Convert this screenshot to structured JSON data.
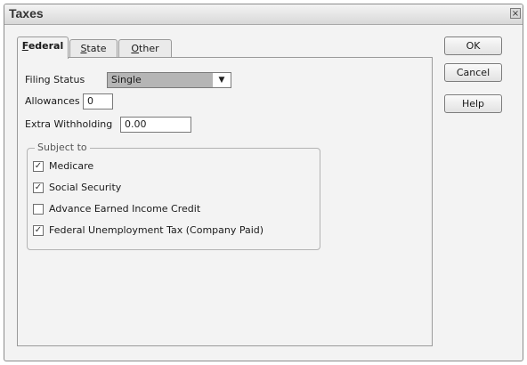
{
  "window": {
    "title": "Taxes",
    "close_glyph": "×"
  },
  "tabs": [
    {
      "label_u": "F",
      "label_rest": "ederal",
      "active": true
    },
    {
      "label_u": "S",
      "label_rest": "tate",
      "active": false
    },
    {
      "label_u": "O",
      "label_rest": "ther",
      "active": false
    }
  ],
  "form": {
    "filing_status_label": "Filing Status",
    "filing_status_value": "Single",
    "dropdown_arrow": "▼",
    "allowances_label": "Allowances",
    "allowances_value": "0",
    "extra_withholding_label": "Extra Withholding",
    "extra_withholding_value": "0.00"
  },
  "subject_to": {
    "title": "Subject to",
    "items": [
      {
        "label": "Medicare",
        "checked": true
      },
      {
        "label": "Social Security",
        "checked": true
      },
      {
        "label": "Advance Earned Income Credit",
        "checked": false
      },
      {
        "label": "Federal Unemployment Tax (Company Paid)",
        "checked": true
      }
    ]
  },
  "buttons": {
    "ok": "OK",
    "cancel": "Cancel",
    "help": "Help"
  }
}
